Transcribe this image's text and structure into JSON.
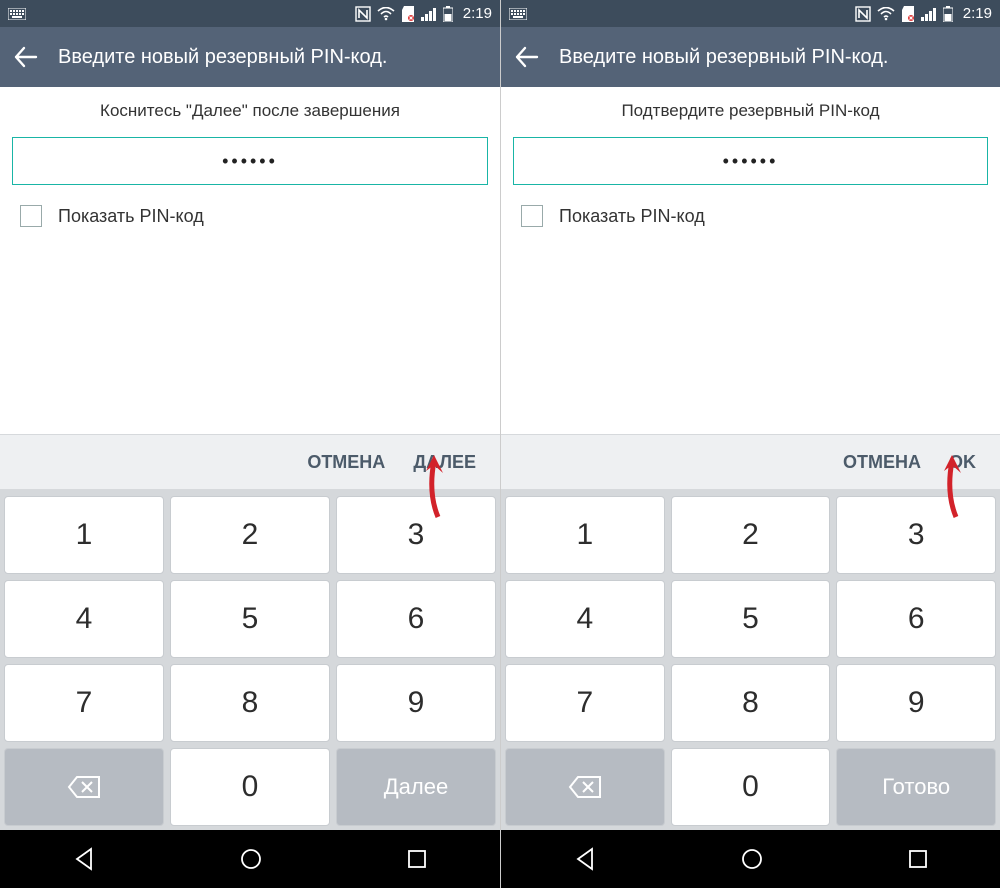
{
  "screens": [
    {
      "statusbar": {
        "time": "2:19"
      },
      "title": "Введите новый резервный PIN-код.",
      "instruction": "Коснитесь \"Далее\" после завершения",
      "pin_dots": "••••••",
      "checkbox_label": "Показать PIN-код",
      "actions": {
        "cancel": "ОТМЕНА",
        "confirm": "ДАЛЕЕ"
      },
      "keypad": {
        "row1": [
          "1",
          "2",
          "3"
        ],
        "row2": [
          "4",
          "5",
          "6"
        ],
        "row3": [
          "7",
          "8",
          "9"
        ],
        "row4_func_left": "backspace",
        "row4_mid": "0",
        "row4_func_right": "Далее"
      }
    },
    {
      "statusbar": {
        "time": "2:19"
      },
      "title": "Введите новый резервный PIN-код.",
      "instruction": "Подтвердите резервный PIN-код",
      "pin_dots": "••••••",
      "checkbox_label": "Показать PIN-код",
      "actions": {
        "cancel": "ОТМЕНА",
        "confirm": "OK"
      },
      "keypad": {
        "row1": [
          "1",
          "2",
          "3"
        ],
        "row2": [
          "4",
          "5",
          "6"
        ],
        "row3": [
          "7",
          "8",
          "9"
        ],
        "row4_func_left": "backspace",
        "row4_mid": "0",
        "row4_func_right": "Готово"
      }
    }
  ],
  "colors": {
    "statusbar": "#3d4c5c",
    "appbar": "#546377",
    "accent_border": "#19b5a6",
    "action_text": "#4c5b6a",
    "annotation_arrow": "#d2222a"
  }
}
